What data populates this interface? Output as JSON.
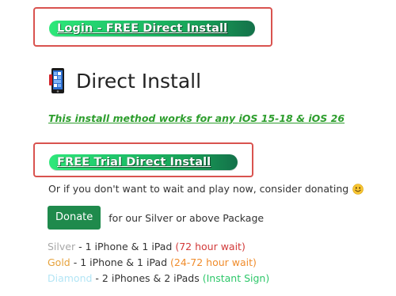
{
  "login_button": {
    "label": "Login - FREE Direct Install"
  },
  "heading": {
    "title": "Direct Install"
  },
  "subtitle": "This install method works for any iOS 15-18 & iOS 26",
  "trial_button": {
    "label": "FREE Trial Direct Install"
  },
  "donate_prompt": "Or if you don't want to wait and play now, consider donating",
  "donate_button": {
    "label": "Donate",
    "after": "for our Silver or above Package"
  },
  "tiers": [
    {
      "name": "Silver",
      "separator": " - ",
      "desc": "1 iPhone & 1 iPad ",
      "wait": "(72 hour wait)",
      "name_color": "#a8a8a8",
      "wait_color": "#d23a3a"
    },
    {
      "name": "Gold",
      "separator": " - ",
      "desc": "1 iPhone & 1 iPad ",
      "wait": "(24-72 hour wait)",
      "name_color": "#e6a23c",
      "wait_color": "#f08c2c"
    },
    {
      "name": "Diamond",
      "separator": " - ",
      "desc": "2 iPhones & 2 iPads ",
      "wait": "(Instant Sign)",
      "name_color": "#b3e5f5",
      "wait_color": "#2ec76a"
    }
  ],
  "colors": {
    "highlight_border": "#d9534f",
    "subtitle_green": "#2e9e2e",
    "donate_button_bg": "#1f8a4c"
  },
  "icons": {
    "heading_icon": "phone-icon",
    "donate_emoji": "smiley-icon"
  }
}
